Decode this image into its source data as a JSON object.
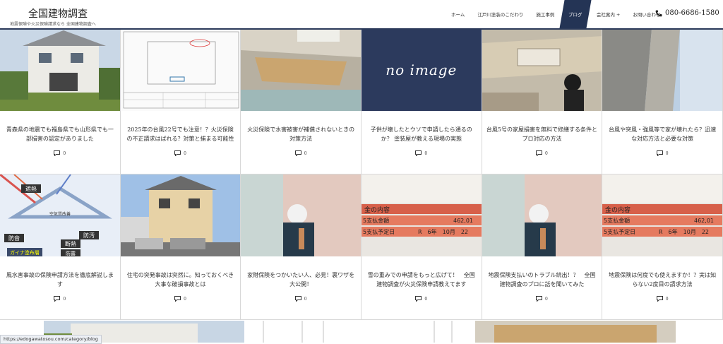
{
  "header": {
    "site_title": "全国建物調査",
    "tagline": "地震保険や火災保険請求なら 全国建物調査へ",
    "phone": "080-6686-1580"
  },
  "nav": [
    {
      "label": "ホーム"
    },
    {
      "label": "江戸川塗装のこだわり"
    },
    {
      "label": "施工事例"
    },
    {
      "label": "ブログ",
      "active": true
    },
    {
      "label": "会社案内  +"
    },
    {
      "label": "お問い合わせ"
    }
  ],
  "posts": [
    {
      "title": "青森県の地震でも福島県でも山形県でも一部損害の認定がありました",
      "comments": "0",
      "thumb": "house-photo"
    },
    {
      "title": "2025年の台風22号でも注意！？火災保険の不正請求はばれる？対策と捕まる可能性",
      "comments": "0",
      "thumb": "document-drawing"
    },
    {
      "title": "火災保険で水害被害が補償されないときの対策方法",
      "comments": "0",
      "thumb": "ceiling-photo"
    },
    {
      "title": "子供が壊したとウソで申請したら通るのか？ 塗装屋が教える現場の実態",
      "comments": "0",
      "thumb": "no-image",
      "no_image_text": "no image"
    },
    {
      "title": "台風5号の家屋損害を無料で修繕する条件とプロ対応の方法",
      "comments": "0",
      "thumb": "ceiling-worker-photo"
    },
    {
      "title": "台風や突風・強風等で家が壊れたら？迅速な対応方法と必要な対策",
      "comments": "0",
      "thumb": "wall-photo"
    },
    {
      "title": "風水害事故の保険申請方法を徹底解説します",
      "comments": "0",
      "thumb": "insulation-diagram",
      "diagram_labels": [
        "遮熱",
        "空気質改善",
        "防音",
        "断熱",
        "防汚",
        "防露",
        "ガイナ塗布層"
      ]
    },
    {
      "title": "住宅の突発事故は突然に。知っておくべき大事な破損事故とは",
      "comments": "0",
      "thumb": "house-photo-2"
    },
    {
      "title": "家財保険をつかいたい人、必見！裏ワザを大公開！",
      "comments": "0",
      "thumb": "worker-photo"
    },
    {
      "title": "雪の重みでの申請をもっと広げて！　全国建物調査が火災保険申請教えてます",
      "comments": "0",
      "thumb": "bank-book",
      "bank_lines": [
        "金の内容",
        "5支払金額",
        "462,01",
        "5支払予定日",
        "R　6年　10月　22"
      ]
    },
    {
      "title": "地震保険支払いのトラブル続出！？　全国建物調査のプロに話を聞いてみた",
      "comments": "0",
      "thumb": "worker-photo"
    },
    {
      "title": "地震保険は何度でも使えますか！？実は知らない2度目の請求方法",
      "comments": "0",
      "thumb": "bank-book",
      "bank_lines": [
        "金の内容",
        "5支払金額",
        "462,01",
        "5支払予定日",
        "R　6年　10月　22"
      ]
    }
  ],
  "status_url": "https://edogawatosou.com/category/blog",
  "colors": {
    "accent": "#243455",
    "no_image_bg": "#2c3a5d"
  }
}
